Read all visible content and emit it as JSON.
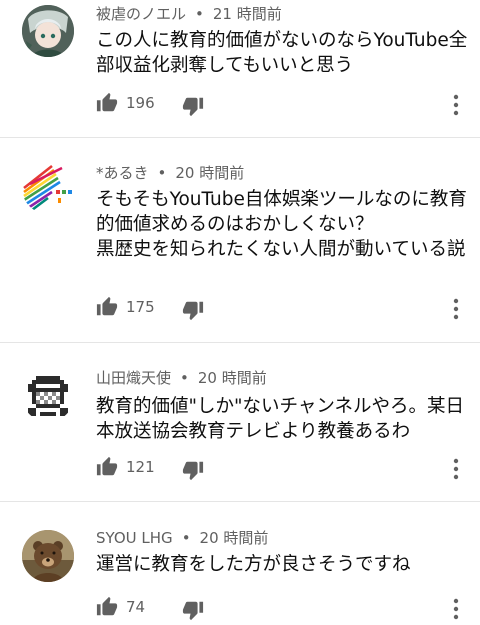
{
  "comments": [
    {
      "author": "被虐のノエル",
      "separator": "•",
      "time": "21 時間前",
      "text": "この人に教育的価値がないのならYouTube全部収益化剥奪してもいいと思う",
      "likes": "196",
      "avatar_icon": "anime-character-avatar"
    },
    {
      "author": "*あるき",
      "separator": "•",
      "time": "20 時間前",
      "text": "そもそもYouTube自体娯楽ツールなのに教育的価値求めるのはおかしくない？\n黒歴史を知られたくない人間が動いている説",
      "likes": "175",
      "avatar_icon": "colorful-stripes-avatar"
    },
    {
      "author": "山田熾天使",
      "separator": "•",
      "time": "20 時間前",
      "text": "教育的価値\"しか\"ないチャンネルやろ。某日本放送協会教育テレビより教養あるわ",
      "likes": "121",
      "avatar_icon": "pixel-art-avatar"
    },
    {
      "author": "SYOU LHG",
      "separator": "•",
      "time": "20 時間前",
      "text": "運営に教育をした方が良さそうですね",
      "likes": "74",
      "avatar_icon": "bear-photo-avatar"
    }
  ],
  "colors": {
    "text": "#0f0f0f",
    "meta": "#606060",
    "icon": "#606060",
    "divider": "#e5e5e5"
  }
}
